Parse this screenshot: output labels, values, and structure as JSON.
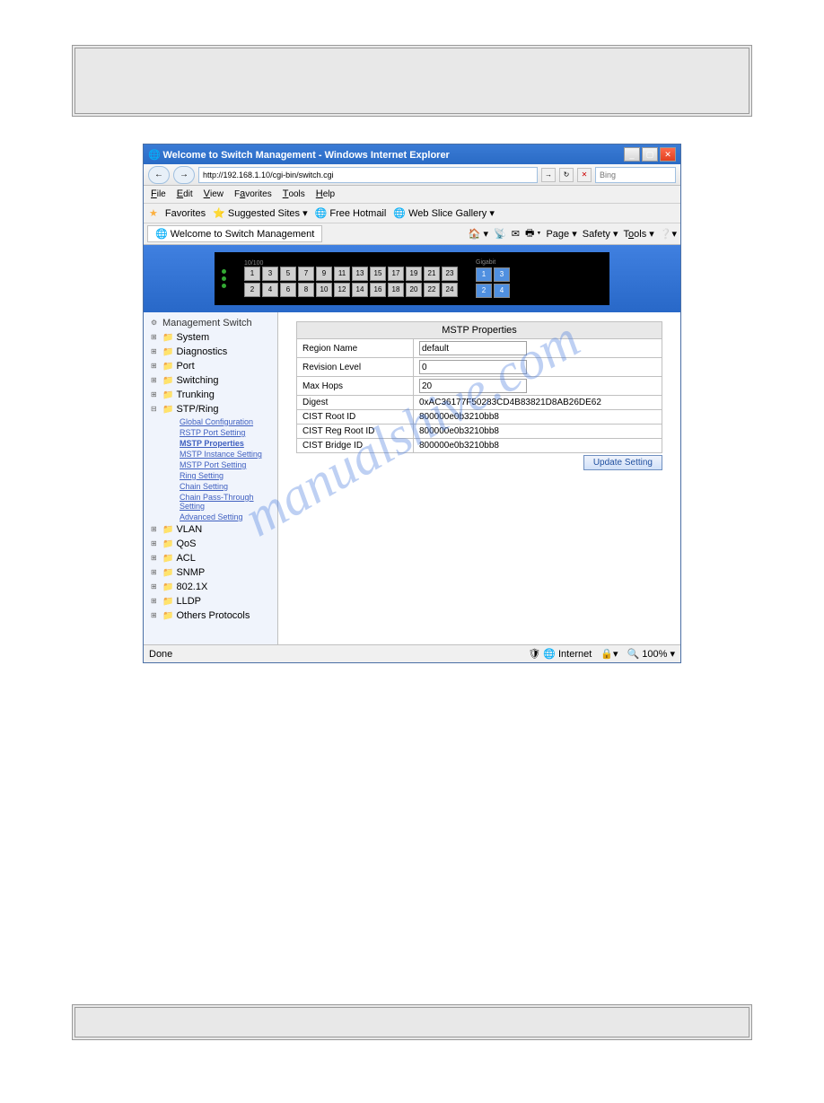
{
  "window": {
    "title": "Welcome to Switch Management - Windows Internet Explorer",
    "url": "http://192.168.1.10/cgi-bin/switch.cgi",
    "search_placeholder": "Bing"
  },
  "menus": {
    "file": "File",
    "edit": "Edit",
    "view": "View",
    "favorites": "Favorites",
    "tools": "Tools",
    "help": "Help"
  },
  "favbar": {
    "favorites": "Favorites",
    "suggested": "Suggested Sites",
    "hotmail": "Free Hotmail",
    "gallery": "Web Slice Gallery"
  },
  "tab": {
    "name": "Welcome to Switch Management"
  },
  "tab_tools": {
    "page": "Page",
    "safety": "Safety",
    "tools": "Tools"
  },
  "ports": {
    "label_10_100": "10/100",
    "label_gigabit": "Gigabit",
    "top": [
      "1",
      "3",
      "5",
      "7",
      "9",
      "11",
      "13",
      "15",
      "17",
      "19",
      "21",
      "23"
    ],
    "bottom": [
      "2",
      "4",
      "6",
      "8",
      "10",
      "12",
      "14",
      "16",
      "18",
      "20",
      "22",
      "24"
    ],
    "gigabit_top": [
      "1",
      "3"
    ],
    "gigabit_bottom": [
      "2",
      "4"
    ]
  },
  "sidebar": {
    "root": "Management Switch",
    "items": [
      {
        "label": "System"
      },
      {
        "label": "Diagnostics"
      },
      {
        "label": "Port"
      },
      {
        "label": "Switching"
      },
      {
        "label": "Trunking"
      },
      {
        "label": "STP/Ring",
        "expanded": true,
        "children": [
          {
            "label": "Global Configuration"
          },
          {
            "label": "RSTP Port Setting"
          },
          {
            "label": "MSTP Properties",
            "active": true
          },
          {
            "label": "MSTP Instance Setting"
          },
          {
            "label": "MSTP Port Setting"
          },
          {
            "label": "Ring Setting"
          },
          {
            "label": "Chain Setting"
          },
          {
            "label": "Chain Pass-Through Setting"
          },
          {
            "label": "Advanced Setting"
          }
        ]
      },
      {
        "label": "VLAN"
      },
      {
        "label": "QoS"
      },
      {
        "label": "ACL"
      },
      {
        "label": "SNMP"
      },
      {
        "label": "802.1X"
      },
      {
        "label": "LLDP"
      },
      {
        "label": "Others Protocols"
      }
    ]
  },
  "panel": {
    "title": "MSTP Properties",
    "rows": [
      {
        "label": "Region Name",
        "value": "default",
        "input": true
      },
      {
        "label": "Revision Level",
        "value": "0",
        "input": true
      },
      {
        "label": "Max Hops",
        "value": "20",
        "input": true
      },
      {
        "label": "Digest",
        "value": "0xAC36177F50283CD4B83821D8AB26DE62",
        "input": false
      },
      {
        "label": "CIST Root ID",
        "value": "800000e0b3210bb8",
        "input": false
      },
      {
        "label": "CIST Reg Root ID",
        "value": "800000e0b3210bb8",
        "input": false
      },
      {
        "label": "CIST Bridge ID",
        "value": "800000e0b3210bb8",
        "input": false
      }
    ],
    "button": "Update Setting"
  },
  "statusbar": {
    "left": "Done",
    "zone": "Internet",
    "zoom": "100%"
  },
  "watermark": "manualshive.com"
}
